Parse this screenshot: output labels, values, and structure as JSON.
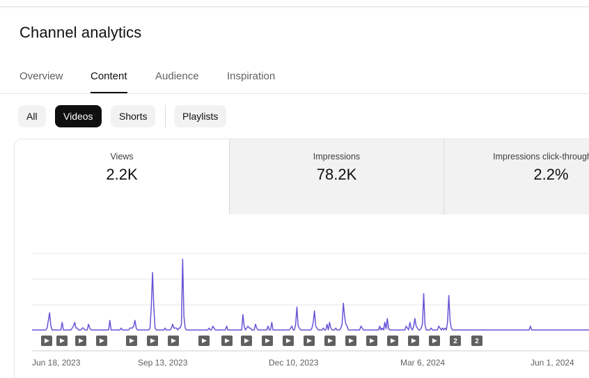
{
  "page": {
    "title": "Channel analytics"
  },
  "tabs": [
    {
      "label": "Overview"
    },
    {
      "label": "Content"
    },
    {
      "label": "Audience"
    },
    {
      "label": "Inspiration"
    }
  ],
  "filters": {
    "chips": [
      {
        "label": "All"
      },
      {
        "label": "Videos"
      },
      {
        "label": "Shorts"
      }
    ],
    "playlists": {
      "label": "Playlists"
    },
    "selected": "Videos"
  },
  "metrics": [
    {
      "label": "Views",
      "value": "2.2K"
    },
    {
      "label": "Impressions",
      "value": "78.2K"
    },
    {
      "label": "Impressions click-through rate",
      "value": "2.2%"
    }
  ],
  "colors": {
    "line": "#6554d6",
    "area": "#cfcbf3",
    "marker": "#606060",
    "grid": "#e5e5e5"
  },
  "chart_data": {
    "type": "line",
    "series": [
      {
        "values": [
          0,
          0,
          0,
          0,
          0,
          0,
          0,
          0,
          0,
          0,
          0,
          0,
          1,
          5,
          9,
          2,
          0,
          0,
          0,
          0,
          0,
          0,
          0,
          0,
          4,
          0,
          0,
          0,
          0,
          0,
          0,
          0,
          1,
          2,
          4,
          1,
          1,
          0,
          0,
          0,
          1,
          1,
          0,
          0,
          0,
          3,
          1,
          0,
          0,
          0,
          0,
          0,
          0,
          0,
          0,
          0,
          0,
          0,
          0,
          0,
          0,
          0,
          5,
          0,
          0,
          0,
          0,
          0,
          0,
          0,
          0,
          1,
          0,
          0,
          0,
          0,
          0,
          0,
          1,
          1,
          1,
          2,
          5,
          1,
          0,
          0,
          0,
          0,
          0,
          0,
          0,
          0,
          0,
          0,
          1,
          12,
          30,
          12,
          1,
          0,
          0,
          0,
          0,
          0,
          0,
          0,
          1,
          0,
          0,
          0,
          0,
          1,
          3,
          1,
          1,
          1,
          0,
          1,
          1,
          3,
          37,
          7,
          1,
          0,
          0,
          0,
          0,
          0,
          0,
          0,
          0,
          0,
          0,
          0,
          0,
          0,
          0,
          0,
          0,
          0,
          0,
          1,
          0,
          0,
          2,
          1,
          0,
          0,
          0,
          0,
          0,
          0,
          0,
          0,
          0,
          2,
          0,
          0,
          0,
          0,
          0,
          0,
          0,
          0,
          0,
          0,
          0,
          0,
          8,
          2,
          0,
          1,
          2,
          1,
          1,
          0,
          0,
          0,
          3,
          1,
          0,
          0,
          0,
          0,
          0,
          0,
          0,
          0,
          2,
          0,
          0,
          4,
          0,
          0,
          0,
          0,
          0,
          0,
          0,
          0,
          0,
          0,
          0,
          0,
          0,
          0,
          1,
          2,
          0,
          0,
          3,
          12,
          2,
          1,
          0,
          0,
          0,
          0,
          0,
          0,
          0,
          0,
          0,
          1,
          4,
          10,
          2,
          1,
          0,
          0,
          0,
          0,
          1,
          0,
          0,
          3,
          0,
          4,
          1,
          0,
          0,
          0,
          1,
          0,
          0,
          0,
          1,
          3,
          14,
          7,
          3,
          2,
          0,
          0,
          0,
          0,
          0,
          0,
          0,
          0,
          0,
          0,
          2,
          1,
          0,
          0,
          0,
          0,
          0,
          0,
          0,
          0,
          0,
          0,
          0,
          0,
          0,
          2,
          0,
          1,
          0,
          4,
          1,
          6,
          1,
          0,
          0,
          0,
          0,
          0,
          0,
          0,
          0,
          0,
          0,
          0,
          0,
          0,
          2,
          1,
          0,
          4,
          1,
          0,
          2,
          6,
          2,
          1,
          0,
          0,
          1,
          3,
          19,
          3,
          0,
          0,
          0,
          0,
          1,
          0,
          0,
          0,
          0,
          0,
          2,
          1,
          0,
          1,
          0,
          1,
          0,
          4,
          18,
          5,
          1,
          0,
          0,
          0,
          0,
          0,
          0,
          0,
          0,
          0,
          0,
          0,
          0,
          0,
          0,
          0,
          0,
          0,
          0,
          0,
          0,
          0,
          0,
          0,
          0,
          0,
          0,
          0,
          0,
          0,
          0,
          0,
          0,
          0,
          0,
          0,
          0,
          0,
          0,
          0,
          0,
          0,
          0,
          0,
          0,
          0,
          0,
          0,
          0,
          0,
          0,
          0,
          0,
          0,
          0,
          0,
          0,
          0,
          0,
          0,
          0,
          0,
          0,
          2,
          0,
          0,
          0,
          0,
          0,
          0,
          0,
          0,
          0,
          0,
          0,
          0,
          0,
          0,
          0,
          0,
          0,
          0,
          0,
          0,
          0,
          0,
          0,
          0,
          0,
          0,
          0,
          0,
          0,
          0,
          0,
          0,
          0,
          0,
          0,
          0,
          0,
          0,
          0,
          0,
          0,
          0,
          0,
          0,
          0,
          0,
          0,
          0,
          0,
          0,
          0,
          0,
          0,
          0,
          0
        ]
      }
    ],
    "x_labels": [
      "Jun 18, 2023",
      "Sep 13, 2023",
      "Dec 10, 2023",
      "Mar 6, 2024",
      "Jun 1, 2024"
    ],
    "ylim": [
      0,
      40
    ],
    "grid": "horizontal",
    "markers": [
      "",
      "",
      "",
      "",
      "",
      "",
      "",
      "",
      "",
      "",
      "",
      "",
      "",
      "",
      "",
      "",
      "",
      "",
      "",
      "2",
      "2"
    ],
    "highlight_range": [
      270,
      288
    ]
  }
}
